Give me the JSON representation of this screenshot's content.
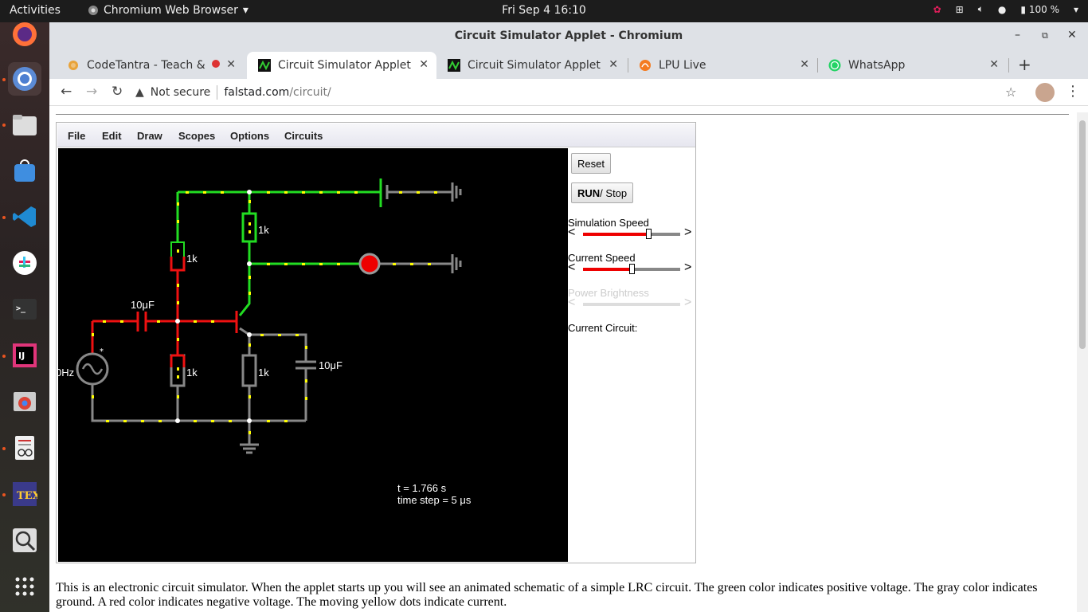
{
  "topbar": {
    "activities": "Activities",
    "app_menu": "Chromium Web Browser",
    "clock": "Fri Sep 4  16:10",
    "battery": "100 %"
  },
  "window": {
    "title": "Circuit Simulator Applet - Chromium"
  },
  "tabs": [
    {
      "label": "CodeTantra - Teach & L",
      "icon": "codetantra-icon",
      "active": false
    },
    {
      "label": "Circuit Simulator Applet",
      "icon": "falstad-icon",
      "active": true
    },
    {
      "label": "Circuit Simulator Applet",
      "icon": "falstad-icon",
      "active": false
    },
    {
      "label": "LPU Live",
      "icon": "lpu-icon",
      "active": false
    },
    {
      "label": "WhatsApp",
      "icon": "whatsapp-icon",
      "active": false
    }
  ],
  "omnibox": {
    "security": "Not secure",
    "host": "falstad.com",
    "path": "/circuit/"
  },
  "applet": {
    "menus": [
      "File",
      "Edit",
      "Draw",
      "Scopes",
      "Options",
      "Circuits"
    ],
    "reset_label": "Reset",
    "run_label": "RUN",
    "stop_label": " / Stop",
    "simulation_speed_label": "Simulation Speed",
    "simulation_speed_value": 0.67,
    "current_speed_label": "Current Speed",
    "current_speed_value": 0.5,
    "power_brightness_label": "Power Brightness",
    "current_circuit_label": "Current Circuit:",
    "time_label": "t = 1.766 s",
    "timestep_label": "time step = 5 μs",
    "components": {
      "r1": "1k",
      "r2": "1k",
      "r3": "1k",
      "r4": "1k",
      "c1": "10μF",
      "c2": "10μF",
      "source": "0Hz"
    }
  },
  "description": "This is an electronic circuit simulator.  When the applet starts up you will see an animated schematic of a simple LRC circuit. The green color indicates positive voltage.  The gray color indicates ground.  A red color indicates negative voltage.  The moving yellow dots indicate current.",
  "colors": {
    "positive": "#22dd22",
    "negative": "#ee1111",
    "ground": "#888888",
    "current_dots": "#ffff00"
  }
}
